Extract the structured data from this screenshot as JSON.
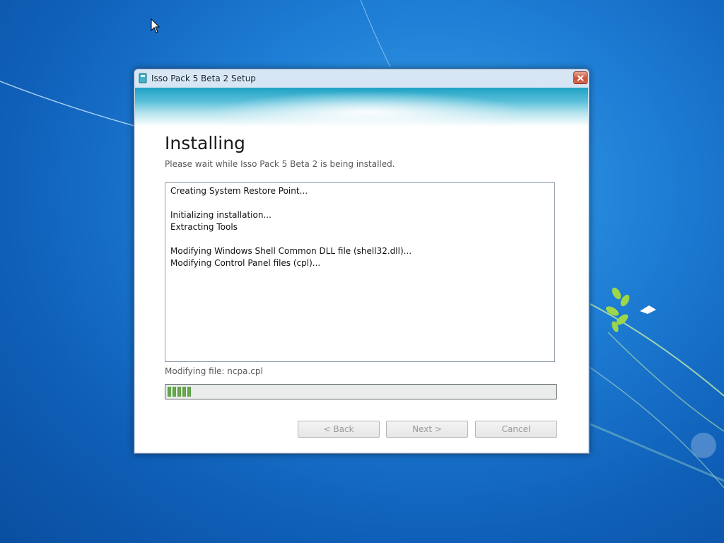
{
  "window": {
    "title": "Isso Pack 5 Beta 2 Setup"
  },
  "page": {
    "heading": "Installing",
    "subtext": "Please wait while Isso Pack 5 Beta 2 is being installed."
  },
  "log": {
    "lines": [
      "Creating System Restore Point...",
      "",
      "Initializing installation...",
      "Extracting Tools",
      "",
      "Modifying Windows Shell Common DLL file (shell32.dll)...",
      "Modifying Control Panel files (cpl)..."
    ]
  },
  "status": {
    "text": "Modifying file: ncpa.cpl"
  },
  "progress": {
    "fraction": 0.06
  },
  "buttons": {
    "back": "< Back",
    "next": "Next >",
    "cancel": "Cancel"
  },
  "colors": {
    "progress_green": "#5a9a46",
    "banner_teal": "#1fa1c4",
    "desktop_blue": "#1f7fd6"
  }
}
